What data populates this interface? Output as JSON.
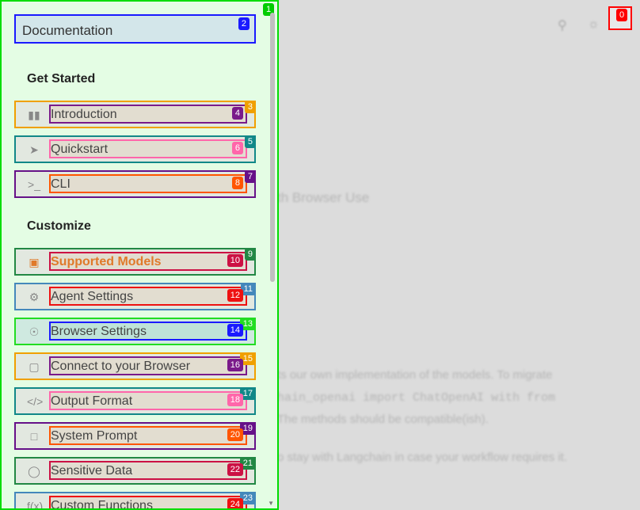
{
  "header": {
    "close_icon": "close-icon",
    "search_icon": "search-icon",
    "theme_icon": "sun-icon"
  },
  "background": {
    "line1": "th Browser Use",
    "para1": "ts our own implementation of the models. To migrate",
    "para2": "hain_openai import ChatOpenAI  with  from",
    "para3": "The methods should be compatible(ish).",
    "para4": "o stay with Langchain in case your workflow requires it."
  },
  "sidebar": {
    "title": "Documentation",
    "sections": [
      {
        "title": "Get Started",
        "items": [
          {
            "label": "Introduction",
            "icon": "book-icon"
          },
          {
            "label": "Quickstart",
            "icon": "rocket-icon"
          },
          {
            "label": "CLI",
            "icon": "terminal-icon"
          }
        ]
      },
      {
        "title": "Customize",
        "items": [
          {
            "label": "Supported Models",
            "icon": "robot-icon"
          },
          {
            "label": "Agent Settings",
            "icon": "gear-icon"
          },
          {
            "label": "Browser Settings",
            "icon": "globe-icon"
          },
          {
            "label": "Connect to your Browser",
            "icon": "monitor-icon"
          },
          {
            "label": "Output Format",
            "icon": "code-icon"
          },
          {
            "label": "System Prompt",
            "icon": "chat-icon"
          },
          {
            "label": "Sensitive Data",
            "icon": "shield-icon"
          },
          {
            "label": "Custom Functions",
            "icon": "function-icon"
          }
        ]
      }
    ]
  },
  "badges": [
    "0",
    "1",
    "2",
    "3",
    "4",
    "5",
    "6",
    "7",
    "8",
    "9",
    "10",
    "11",
    "12",
    "13",
    "14",
    "15",
    "16",
    "17",
    "18",
    "19",
    "20",
    "21",
    "22",
    "23",
    "24"
  ],
  "colors": {
    "sidebar_bg": "#e4fde4",
    "sidebar_border": "#00dd00",
    "accent_orange": "#e07a2a"
  }
}
